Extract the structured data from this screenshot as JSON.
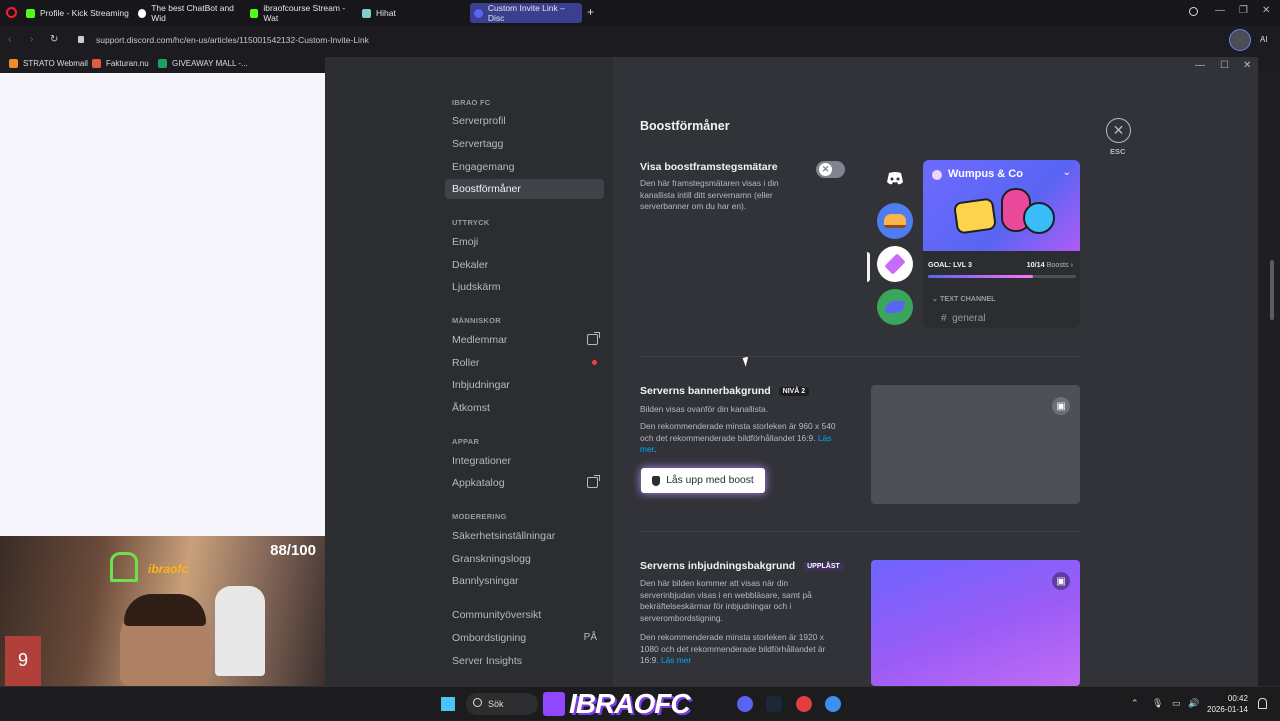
{
  "browser": {
    "tabs": [
      {
        "title": "Profile - Kick Streaming",
        "color": "#53fc18"
      },
      {
        "title": "The best ChatBot and Wid",
        "color": "#ffffff"
      },
      {
        "title": "ibraofcourse Stream - Wat",
        "color": "#53fc18"
      },
      {
        "title": "Hihat",
        "color": "#7fd1c7"
      },
      {
        "title": "Custom Invite Link – Disc",
        "color": "#5865f2"
      }
    ],
    "url": "support.discord.com/hc/en-us/articles/115001542132-Custom-Invite-Link",
    "bookmarks": [
      {
        "label": "STRATO Webmail",
        "color": "#f28c28"
      },
      {
        "label": "Fakturan.nu",
        "color": "#e05a47"
      },
      {
        "label": "GIVEAWAY MALL -...",
        "color": "#1aa260"
      }
    ]
  },
  "webcam": {
    "count": "88/100",
    "neon_text": "ibraofc",
    "shirt_number": "9"
  },
  "sidebar": {
    "server_label": "IBRAO FC",
    "server_items": [
      "Serverprofil",
      "Servertagg",
      "Engagemang",
      "Boostförmåner"
    ],
    "expression_label": "UTTRYCK",
    "expression_items": [
      "Emoji",
      "Dekaler",
      "Ljudskärm"
    ],
    "people_label": "MÄNNISKOR",
    "people_items": [
      "Medlemmar",
      "Roller",
      "Inbjudningar",
      "Åtkomst"
    ],
    "apps_label": "APPAR",
    "apps_items": [
      "Integrationer",
      "Appkatalog"
    ],
    "moderation_label": "MODERERING",
    "moderation_items": [
      "Säkerhetsinställningar",
      "Granskningslogg",
      "Bannlysningar"
    ],
    "community_items": [
      "Communityöversikt",
      "Ombordstigning",
      "Server Insights"
    ],
    "onboarding_state": "PÅ"
  },
  "content": {
    "title": "Boostförmåner",
    "close_label": "ESC",
    "progress_bar": {
      "title": "Visa boostframstegsmätare",
      "desc_1": "Den här framstegsmätaren visas i din",
      "desc_2": "kanallista intill ditt servernamn (eller",
      "desc_3": "serverbanner om du har en).",
      "enabled": false
    },
    "preview": {
      "server_name": "Wumpus & Co",
      "goal": "GOAL: LVL 3",
      "boosts_count": "10/14",
      "boosts_label": "Boosts",
      "boost_progress": 0.71,
      "section": "TEXT CHANNEL",
      "channel": "general"
    },
    "banner": {
      "title": "Serverns bannerbakgrund",
      "badge": "NIVÅ 2",
      "desc_1": "Bilden visas ovanför din kanallista.",
      "desc_2": "Den rekommenderade minsta storleken är 960 x 540",
      "desc_3": "och det rekommenderade bildförhållandet 16:9.",
      "link_a": "Läs",
      "link_b": "mer",
      "link_tail": ".",
      "button": "Lås upp med boost"
    },
    "invite": {
      "title": "Serverns inbjudningsbakgrund",
      "badge": "UPPLÅST",
      "desc_1": "Den här bilden kommer att visas när din",
      "desc_2": "serverinbjudan visas i en webbläsare, samt på",
      "desc_3": "bekräftelseskärmar för inbjudningar och i",
      "desc_4": "serverombordstigning.",
      "desc_5": "Den rekommenderade minsta storleken är 1920 x",
      "desc_6": "1080 och det rekommenderade bildförhållandet är",
      "desc_7": "16:9.",
      "link": "Läs mer"
    }
  },
  "taskbar": {
    "search": "Sök",
    "brand": "IBRAOFC",
    "time": "00:42",
    "date": "2026-01-14"
  }
}
